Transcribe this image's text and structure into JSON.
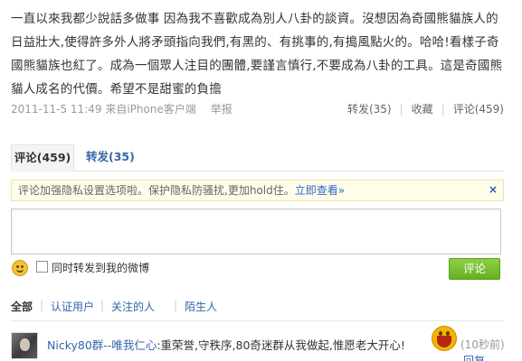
{
  "post": {
    "text": "一直以來我都少說話多做事 因為我不喜歡成為別人八卦的談資。沒想因為奇國熊貓族人的日益壯大,使得許多外人將矛頭指向我們,有黑的、有挑事的,有搗風點火的。哈哈!看樣子奇國熊貓族也紅了。成為一個眾人注目的團體,要謹言慎行,不要成為八卦的工具。這是奇國熊貓人成名的代價。希望不是甜蜜的負擔",
    "time": "2011-11-5 11:49",
    "source_prefix": "来自",
    "source": "iPhone客户端",
    "report": "举报",
    "actions": {
      "repost": "转发(35)",
      "favorite": "收藏",
      "comment": "评论(459)"
    }
  },
  "tabs": {
    "comments_label": "评论",
    "comments_count": "(459)",
    "reposts": "转发(35)"
  },
  "notice": {
    "text": "评论加强隐私设置选项啦。保护隐私防骚扰,更加hold住。",
    "link": "立即查看»",
    "close": "×"
  },
  "composer": {
    "placeholder": "",
    "also_repost_label": "同时转发到我的微博",
    "submit_label": "评论"
  },
  "filters": {
    "all": "全部",
    "verified": "认证用户",
    "following": "关注的人",
    "strangers": "陌生人",
    "pipe": "|"
  },
  "comments": [
    {
      "user": "Nicky80群--唯我仁心",
      "body": ":重荣誉,守秩序,80奇迷群从我做起,惟愿老大开心!",
      "time": "(10秒前)",
      "reply": "回复"
    }
  ],
  "colors": {
    "link": "#3366aa",
    "submit_bg": "#74bd2e",
    "notice_bg": "#fefdea"
  },
  "icons": {
    "emoji_button": "smiley-icon",
    "comment_emoji": "laughing-emoji-icon",
    "notice_close": "close-icon"
  }
}
